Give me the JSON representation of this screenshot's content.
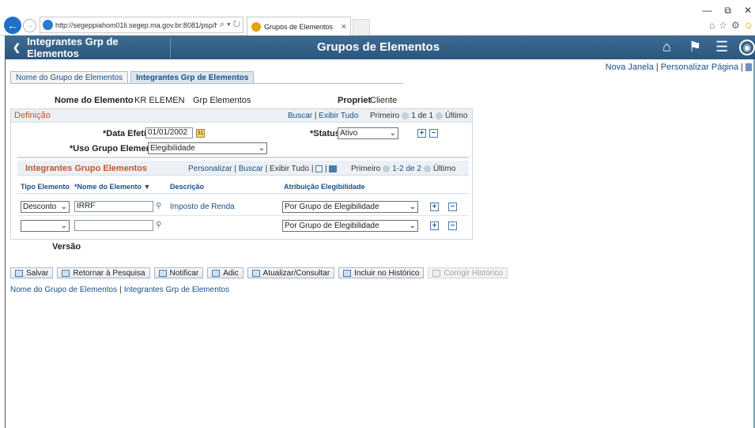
{
  "browser": {
    "url": "http://segeppiahom01li.segep.ma.gov.br:8081/psp/hı",
    "addr_tools": "⌕ ▾ ↻",
    "tab_title": "Grupos de Elementos",
    "tab_close": "×",
    "window_controls": [
      "—",
      "⧉",
      "✕"
    ],
    "command_icons": [
      "home-icon",
      "star-icon",
      "gear-icon",
      "smiley-icon"
    ]
  },
  "header": {
    "back_label": "Integrantes Grp de Elementos",
    "title": "Grupos de Elementos",
    "bg_color": "#2f5c85"
  },
  "page_links": {
    "new_window": "Nova Janela",
    "personalize": "Personalizar Página"
  },
  "tabs": [
    {
      "label": "Nome do Grupo de Elementos",
      "active": false
    },
    {
      "label": "Integrantes Grp de Elementos",
      "active": true
    }
  ],
  "fields": {
    "element_name_label": "Nome do Elemento",
    "element_name_value": "KR ELEMEN",
    "element_group_value": "Grp Elementos",
    "owner_label": "Propriet",
    "owner_value": "Cliente"
  },
  "definicao": {
    "title": "Definição",
    "find": "Buscar",
    "view_all": "Exibir Tudo",
    "first": "Primeiro",
    "counter": "1 de 1",
    "last": "Último",
    "effdt_label": "*Data Efetiva",
    "effdt_value": "01/01/2002",
    "status_label": "*Status",
    "status_value": "Ativo",
    "uso_label": "*Uso Grupo Elementos",
    "uso_value": "Elegibilidade",
    "versao_label": "Versão"
  },
  "grid": {
    "title": "Integrantes Grupo Elementos",
    "personalize": "Personalizar",
    "find": "Buscar",
    "view_all": "Exibir Tudo",
    "first": "Primeiro",
    "counter": "1-2 de 2",
    "last": "Último",
    "headers": {
      "tipo": "Tipo Elemento",
      "nome": "*Nome do Elemento",
      "descricao": "Descrição",
      "atribuicao": "Atribuição Elegibilidade"
    },
    "rows": [
      {
        "tipo": "Desconto",
        "nome": "IRRF",
        "descricao": "Imposto de Renda",
        "atribuicao": "Por Grupo de Elegibilidade"
      },
      {
        "tipo": "",
        "nome": "",
        "descricao": "",
        "atribuicao": "Por Grupo de Elegibilidade"
      }
    ]
  },
  "actions": {
    "save": "Salvar",
    "return": "Retornar à Pesquisa",
    "notify": "Notificar",
    "add": "Adic",
    "update": "Atualizar/Consultar",
    "include_history": "Incluir no Histórico",
    "correct_history": "Corrigir Histórico"
  },
  "bottom_links": {
    "link1": "Nome do Grupo de Elementos",
    "link2": "Integrantes Grp de Elementos"
  }
}
